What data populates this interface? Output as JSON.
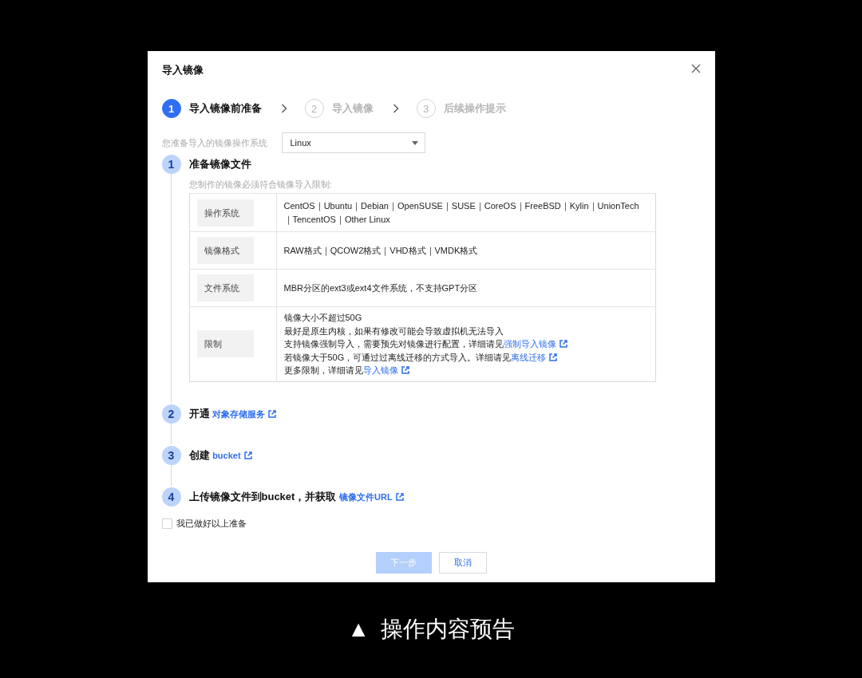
{
  "dialog": {
    "title": "导入镜像"
  },
  "stepper": [
    {
      "number": "1",
      "label": "导入镜像前准备",
      "selected": true
    },
    {
      "number": "2",
      "label": "导入镜像",
      "selected": false
    },
    {
      "number": "3",
      "label": "后续操作提示",
      "selected": false
    }
  ],
  "os_select": {
    "label": "您准备导入的镜像操作系统",
    "value": "Linux"
  },
  "tasks": [
    {
      "number": "1",
      "title": "准备镜像文件",
      "note": "您制作的镜像必须符合镜像导入限制:",
      "table": [
        {
          "header": "操作系统",
          "lines": [
            {
              "text": "CentOS｜Ubuntu｜Debian｜OpenSUSE｜SUSE｜CoreOS｜FreeBSD｜Kylin｜UnionTech｜TencentOS｜Other Linux"
            }
          ]
        },
        {
          "header": "镜像格式",
          "lines": [
            {
              "text": "RAW格式｜QCOW2格式｜VHD格式｜VMDK格式"
            }
          ]
        },
        {
          "header": "文件系统",
          "lines": [
            {
              "text": "MBR分区的ext3或ext4文件系统，不支持GPT分区"
            }
          ]
        },
        {
          "header": "限制",
          "lines": [
            {
              "text": "镜像大小不超过50G"
            },
            {
              "text": "最好是原生内核，如果有修改可能会导致虚拟机无法导入"
            },
            {
              "text": "支持镜像强制导入，需要预先对镜像进行配置，详细请见",
              "link": "强制导入镜像"
            },
            {
              "text": "若镜像大于50G，可通过过离线迁移的方式导入。详细请见",
              "link": "离线迁移"
            },
            {
              "text": "更多限制，详细请见",
              "link": "导入镜像"
            }
          ]
        }
      ]
    },
    {
      "number": "2",
      "title": "开通",
      "link": "对象存储服务"
    },
    {
      "number": "3",
      "title": "创建",
      "link": "bucket"
    },
    {
      "number": "4",
      "title": "上传镜像文件到bucket，并获取",
      "link": "镜像文件URL"
    }
  ],
  "agreement": {
    "label": "我已做好以上准备",
    "checked": false
  },
  "buttons": [
    {
      "label": "下一步",
      "kind": "primary",
      "disabled": true
    },
    {
      "label": "取消",
      "kind": "secondary",
      "disabled": false
    }
  ],
  "caption": {
    "mark": "▲",
    "text": "操作内容预告"
  }
}
